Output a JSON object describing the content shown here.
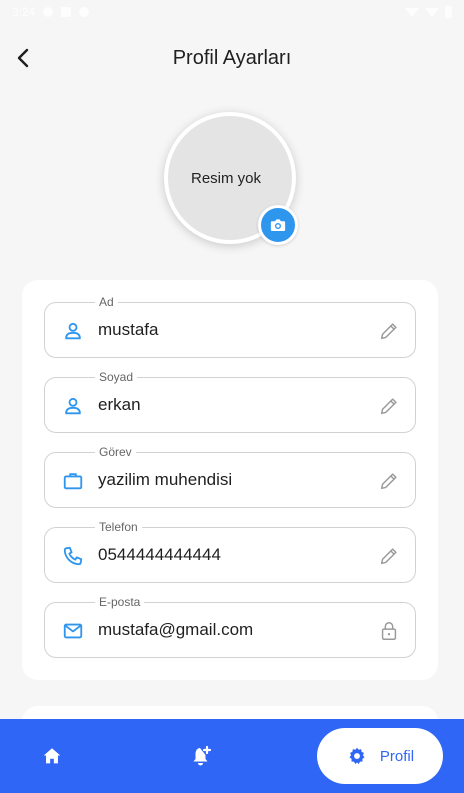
{
  "status_bar": {
    "time": "3:24"
  },
  "app_bar": {
    "title": "Profil Ayarları"
  },
  "avatar": {
    "placeholder_text": "Resim yok"
  },
  "fields": [
    {
      "label": "Ad",
      "value": "mustafa",
      "icon": "person-icon",
      "action": "edit-icon"
    },
    {
      "label": "Soyad",
      "value": "erkan",
      "icon": "person-icon",
      "action": "edit-icon"
    },
    {
      "label": "Görev",
      "value": "yazilim muhendisi",
      "icon": "briefcase-icon",
      "action": "edit-icon"
    },
    {
      "label": "Telefon",
      "value": "0544444444444",
      "icon": "phone-icon",
      "action": "edit-icon"
    },
    {
      "label": "E-posta",
      "value": "mustafa@gmail.com",
      "icon": "mail-icon",
      "action": "lock-icon"
    }
  ],
  "bottom_nav": {
    "items": [
      {
        "icon": "home-icon"
      },
      {
        "icon": "add-notification-icon"
      }
    ],
    "active": {
      "icon": "settings-icon",
      "label": "Profil"
    }
  },
  "colors": {
    "accent": "#2f96ee",
    "nav_background": "#2f66f6",
    "background": "#f6f6f6"
  }
}
